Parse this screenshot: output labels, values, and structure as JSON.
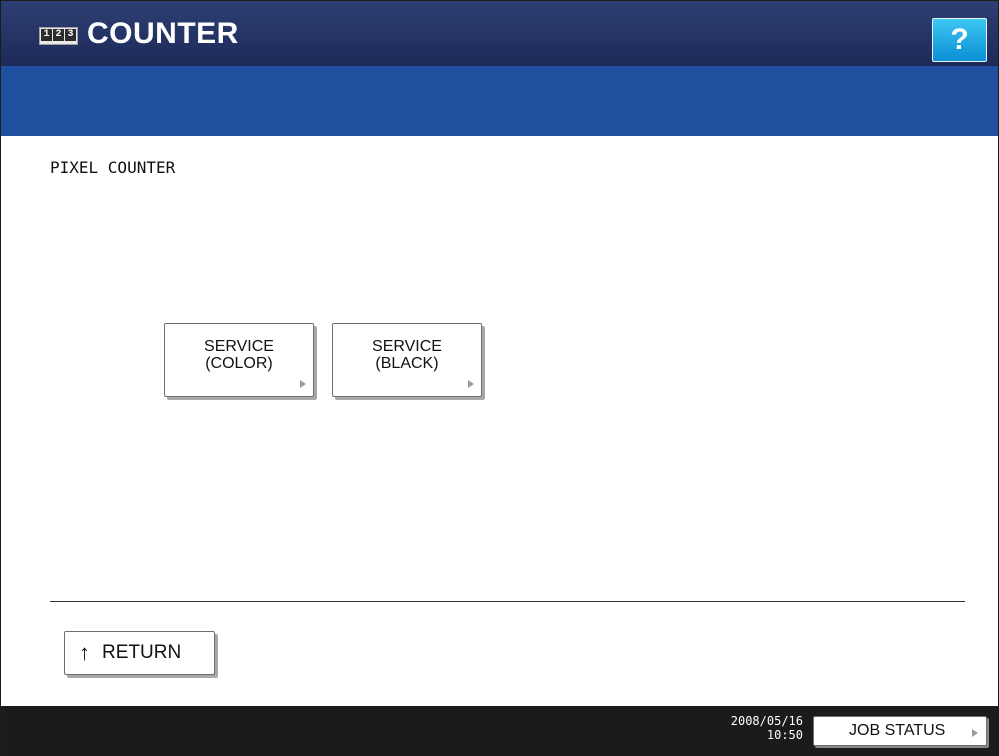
{
  "header": {
    "icon_digits": [
      "1",
      "2",
      "3"
    ],
    "title": "COUNTER",
    "help_label": "?"
  },
  "main": {
    "section_title": "PIXEL COUNTER",
    "buttons": [
      {
        "label": "SERVICE\n(COLOR)"
      },
      {
        "label": "SERVICE\n(BLACK)"
      }
    ],
    "return_label": "RETURN",
    "return_icon": "↑"
  },
  "status_bar": {
    "date": "2008/05/16",
    "time": "10:50",
    "job_status_label": "JOB STATUS"
  },
  "colors": {
    "title_bar": "#25346a",
    "band": "#1f4f9f",
    "help_button": "#1aa6e6",
    "status_bar": "#1b1b1b"
  }
}
